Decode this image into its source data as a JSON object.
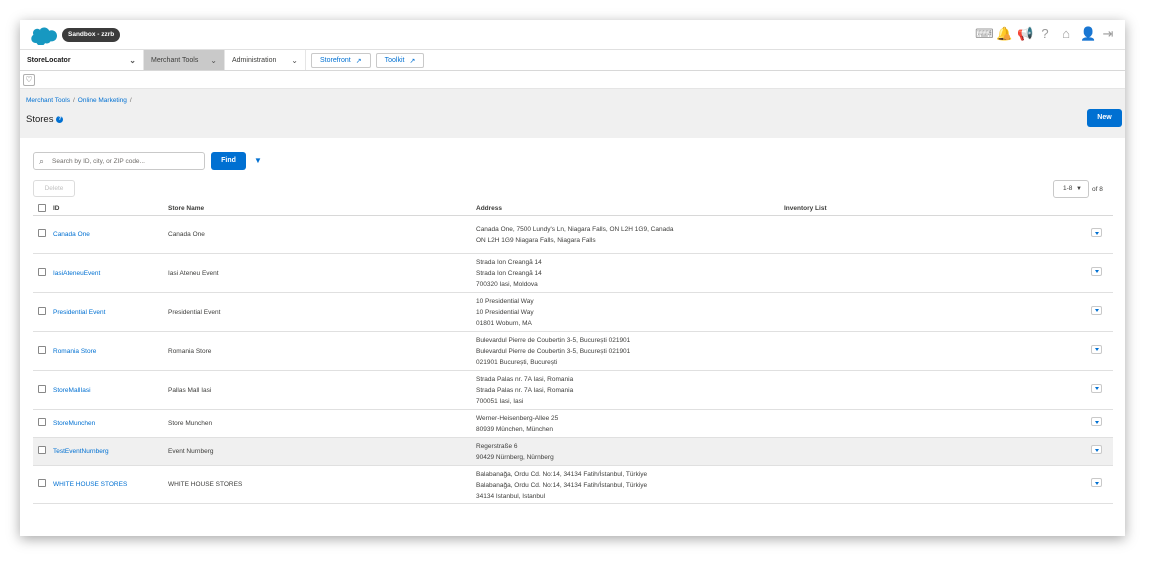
{
  "topbar": {
    "sandbox_label": "Sandbox - zzrb",
    "icons": [
      "keyboard-icon",
      "notifications-icon",
      "announcement-icon",
      "help-icon",
      "home-icon",
      "user-icon",
      "logout-icon"
    ]
  },
  "nav": {
    "site": "StoreLocator",
    "merchant_tools": "Merchant Tools",
    "administration": "Administration",
    "storefront": "Storefront",
    "toolkit": "Toolkit"
  },
  "breadcrumb": {
    "item1": "Merchant Tools",
    "item2": "Online Marketing"
  },
  "page": {
    "title": "Stores",
    "new_label": "New"
  },
  "search": {
    "placeholder": "Search by ID, city, or ZIP code...",
    "value": "",
    "find_label": "Find"
  },
  "toolbar": {
    "delete_label": "Delete"
  },
  "pagination": {
    "range": "1-8",
    "of_label": "of 8"
  },
  "table": {
    "columns": {
      "id": "ID",
      "name": "Store Name",
      "address": "Address",
      "inventory": "Inventory List"
    },
    "rows": [
      {
        "id": "Canada One",
        "name": "Canada One",
        "address": [
          "Canada One, 7500 Lundy's Ln, Niagara Falls, ON L2H 1G9, Canada",
          "ON L2H 1G9 Niagara Falls, Niagara Falls"
        ],
        "highlight": false
      },
      {
        "id": "IasiAteneuEvent",
        "name": "Iasi Ateneu Event",
        "address": [
          "Strada Ion Creangă 14",
          "Strada Ion Creangă 14",
          "700320 Iasi, Moldova"
        ],
        "highlight": false
      },
      {
        "id": "Presidential Event",
        "name": "Presidential Event",
        "address": [
          "10 Presidential Way",
          "10 Presidential Way",
          "01801 Woburn, MA"
        ],
        "highlight": false
      },
      {
        "id": "Romania Store",
        "name": "Romania Store",
        "address": [
          "Bulevardul Pierre de Coubertin 3-5, București 021901",
          "Bulevardul Pierre de Coubertin 3-5, București 021901",
          "021901 București, București"
        ],
        "highlight": false
      },
      {
        "id": "StoreMallIasi",
        "name": "Pallas Mall Iasi",
        "address": [
          "Strada Palas nr. 7A Iasi, Romania",
          "Strada Palas nr. 7A Iasi, Romania",
          "700051 Iasi, Iasi"
        ],
        "highlight": false
      },
      {
        "id": "StoreMunchen",
        "name": "Store Munchen",
        "address": [
          "Werner-Heisenberg-Allee 25",
          "80939 München, München"
        ],
        "highlight": false
      },
      {
        "id": "TestEventNurnberg",
        "name": "Event Nurnberg",
        "address": [
          "Regerstraße 6",
          "90429 Nürnberg, Nürnberg"
        ],
        "highlight": true
      },
      {
        "id": "WHITE HOUSE STORES",
        "name": "WHITE HOUSE STORES",
        "address": [
          "Balabanağa, Ordu Cd. No:14, 34134 Fatih/İstanbul, Türkiye",
          "Balabanağa, Ordu Cd. No:14, 34134 Fatih/İstanbul, Türkiye",
          "34134 Istanbul, Istanbul"
        ],
        "highlight": false
      }
    ]
  }
}
